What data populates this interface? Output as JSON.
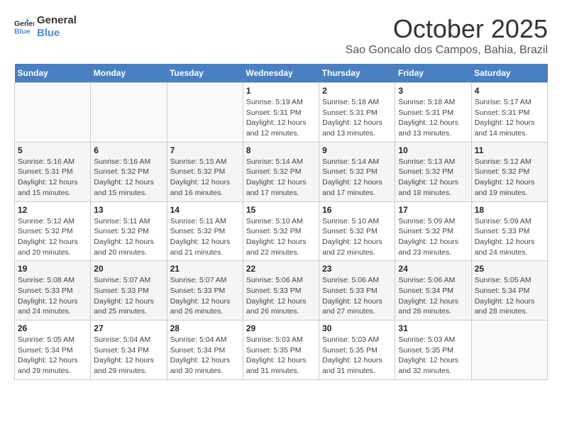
{
  "header": {
    "logo_line1": "General",
    "logo_line2": "Blue",
    "month_year": "October 2025",
    "location": "Sao Goncalo dos Campos, Bahia, Brazil"
  },
  "weekdays": [
    "Sunday",
    "Monday",
    "Tuesday",
    "Wednesday",
    "Thursday",
    "Friday",
    "Saturday"
  ],
  "weeks": [
    [
      {
        "day": "",
        "sunrise": "",
        "sunset": "",
        "daylight": ""
      },
      {
        "day": "",
        "sunrise": "",
        "sunset": "",
        "daylight": ""
      },
      {
        "day": "",
        "sunrise": "",
        "sunset": "",
        "daylight": ""
      },
      {
        "day": "1",
        "sunrise": "Sunrise: 5:19 AM",
        "sunset": "Sunset: 5:31 PM",
        "daylight": "Daylight: 12 hours and 12 minutes."
      },
      {
        "day": "2",
        "sunrise": "Sunrise: 5:18 AM",
        "sunset": "Sunset: 5:31 PM",
        "daylight": "Daylight: 12 hours and 13 minutes."
      },
      {
        "day": "3",
        "sunrise": "Sunrise: 5:18 AM",
        "sunset": "Sunset: 5:31 PM",
        "daylight": "Daylight: 12 hours and 13 minutes."
      },
      {
        "day": "4",
        "sunrise": "Sunrise: 5:17 AM",
        "sunset": "Sunset: 5:31 PM",
        "daylight": "Daylight: 12 hours and 14 minutes."
      }
    ],
    [
      {
        "day": "5",
        "sunrise": "Sunrise: 5:16 AM",
        "sunset": "Sunset: 5:31 PM",
        "daylight": "Daylight: 12 hours and 15 minutes."
      },
      {
        "day": "6",
        "sunrise": "Sunrise: 5:16 AM",
        "sunset": "Sunset: 5:32 PM",
        "daylight": "Daylight: 12 hours and 15 minutes."
      },
      {
        "day": "7",
        "sunrise": "Sunrise: 5:15 AM",
        "sunset": "Sunset: 5:32 PM",
        "daylight": "Daylight: 12 hours and 16 minutes."
      },
      {
        "day": "8",
        "sunrise": "Sunrise: 5:14 AM",
        "sunset": "Sunset: 5:32 PM",
        "daylight": "Daylight: 12 hours and 17 minutes."
      },
      {
        "day": "9",
        "sunrise": "Sunrise: 5:14 AM",
        "sunset": "Sunset: 5:32 PM",
        "daylight": "Daylight: 12 hours and 17 minutes."
      },
      {
        "day": "10",
        "sunrise": "Sunrise: 5:13 AM",
        "sunset": "Sunset: 5:32 PM",
        "daylight": "Daylight: 12 hours and 18 minutes."
      },
      {
        "day": "11",
        "sunrise": "Sunrise: 5:12 AM",
        "sunset": "Sunset: 5:32 PM",
        "daylight": "Daylight: 12 hours and 19 minutes."
      }
    ],
    [
      {
        "day": "12",
        "sunrise": "Sunrise: 5:12 AM",
        "sunset": "Sunset: 5:32 PM",
        "daylight": "Daylight: 12 hours and 20 minutes."
      },
      {
        "day": "13",
        "sunrise": "Sunrise: 5:11 AM",
        "sunset": "Sunset: 5:32 PM",
        "daylight": "Daylight: 12 hours and 20 minutes."
      },
      {
        "day": "14",
        "sunrise": "Sunrise: 5:11 AM",
        "sunset": "Sunset: 5:32 PM",
        "daylight": "Daylight: 12 hours and 21 minutes."
      },
      {
        "day": "15",
        "sunrise": "Sunrise: 5:10 AM",
        "sunset": "Sunset: 5:32 PM",
        "daylight": "Daylight: 12 hours and 22 minutes."
      },
      {
        "day": "16",
        "sunrise": "Sunrise: 5:10 AM",
        "sunset": "Sunset: 5:32 PM",
        "daylight": "Daylight: 12 hours and 22 minutes."
      },
      {
        "day": "17",
        "sunrise": "Sunrise: 5:09 AM",
        "sunset": "Sunset: 5:32 PM",
        "daylight": "Daylight: 12 hours and 23 minutes."
      },
      {
        "day": "18",
        "sunrise": "Sunrise: 5:09 AM",
        "sunset": "Sunset: 5:33 PM",
        "daylight": "Daylight: 12 hours and 24 minutes."
      }
    ],
    [
      {
        "day": "19",
        "sunrise": "Sunrise: 5:08 AM",
        "sunset": "Sunset: 5:33 PM",
        "daylight": "Daylight: 12 hours and 24 minutes."
      },
      {
        "day": "20",
        "sunrise": "Sunrise: 5:07 AM",
        "sunset": "Sunset: 5:33 PM",
        "daylight": "Daylight: 12 hours and 25 minutes."
      },
      {
        "day": "21",
        "sunrise": "Sunrise: 5:07 AM",
        "sunset": "Sunset: 5:33 PM",
        "daylight": "Daylight: 12 hours and 26 minutes."
      },
      {
        "day": "22",
        "sunrise": "Sunrise: 5:06 AM",
        "sunset": "Sunset: 5:33 PM",
        "daylight": "Daylight: 12 hours and 26 minutes."
      },
      {
        "day": "23",
        "sunrise": "Sunrise: 5:06 AM",
        "sunset": "Sunset: 5:33 PM",
        "daylight": "Daylight: 12 hours and 27 minutes."
      },
      {
        "day": "24",
        "sunrise": "Sunrise: 5:06 AM",
        "sunset": "Sunset: 5:34 PM",
        "daylight": "Daylight: 12 hours and 28 minutes."
      },
      {
        "day": "25",
        "sunrise": "Sunrise: 5:05 AM",
        "sunset": "Sunset: 5:34 PM",
        "daylight": "Daylight: 12 hours and 28 minutes."
      }
    ],
    [
      {
        "day": "26",
        "sunrise": "Sunrise: 5:05 AM",
        "sunset": "Sunset: 5:34 PM",
        "daylight": "Daylight: 12 hours and 29 minutes."
      },
      {
        "day": "27",
        "sunrise": "Sunrise: 5:04 AM",
        "sunset": "Sunset: 5:34 PM",
        "daylight": "Daylight: 12 hours and 29 minutes."
      },
      {
        "day": "28",
        "sunrise": "Sunrise: 5:04 AM",
        "sunset": "Sunset: 5:34 PM",
        "daylight": "Daylight: 12 hours and 30 minutes."
      },
      {
        "day": "29",
        "sunrise": "Sunrise: 5:03 AM",
        "sunset": "Sunset: 5:35 PM",
        "daylight": "Daylight: 12 hours and 31 minutes."
      },
      {
        "day": "30",
        "sunrise": "Sunrise: 5:03 AM",
        "sunset": "Sunset: 5:35 PM",
        "daylight": "Daylight: 12 hours and 31 minutes."
      },
      {
        "day": "31",
        "sunrise": "Sunrise: 5:03 AM",
        "sunset": "Sunset: 5:35 PM",
        "daylight": "Daylight: 12 hours and 32 minutes."
      },
      {
        "day": "",
        "sunrise": "",
        "sunset": "",
        "daylight": ""
      }
    ]
  ]
}
